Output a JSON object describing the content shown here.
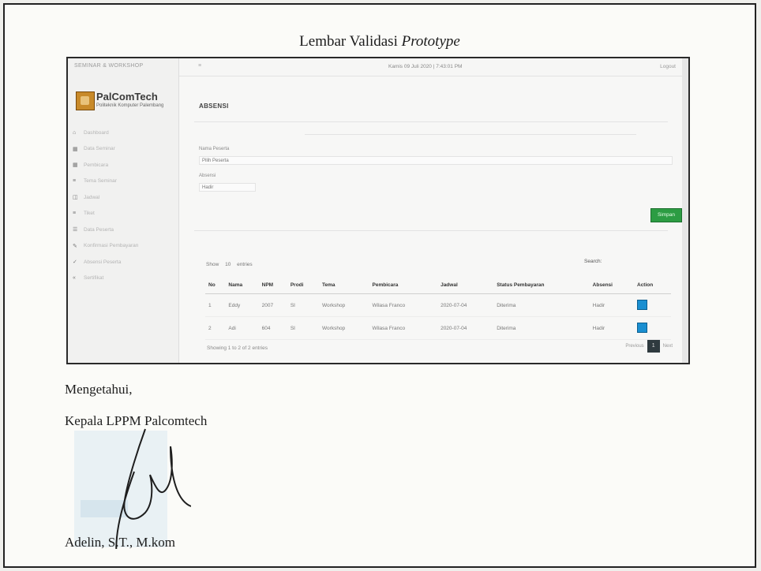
{
  "document": {
    "title_prefix": "Lembar Validasi",
    "title_italic": "Prototype",
    "acknowledged": "Mengetahui,",
    "position": "Kepala LPPM Palcomtech",
    "signer": "Adelin, S.T., M.kom"
  },
  "app": {
    "sidebar_header": "SEMINAR & WORKSHOP",
    "logo_name": "PalComTech",
    "logo_tagline": "Politeknik Komputer Palembang",
    "menu": [
      {
        "icon": "home-icon",
        "glyph": "⌂",
        "label": "Dashboard"
      },
      {
        "icon": "grid-icon",
        "glyph": "▦",
        "label": "Data Seminar"
      },
      {
        "icon": "grid-icon",
        "glyph": "▦",
        "label": "Pembicara"
      },
      {
        "icon": "list-icon",
        "glyph": "≡",
        "label": "Tema Seminar"
      },
      {
        "icon": "calendar-icon",
        "glyph": "◫",
        "label": "Jadwal"
      },
      {
        "icon": "list-icon",
        "glyph": "≡",
        "label": "Tiket"
      },
      {
        "icon": "users-icon",
        "glyph": "☰",
        "label": "Data Peserta"
      },
      {
        "icon": "edit-icon",
        "glyph": "✎",
        "label": "Konfirmasi Pembayaran"
      },
      {
        "icon": "check-icon",
        "glyph": "✓",
        "label": "Absensi Peserta"
      },
      {
        "icon": "chevron-icon",
        "glyph": "«",
        "label": "Sertifikat"
      }
    ],
    "topbar_toggle": "≡",
    "topbar_datetime": "Kamis 09 Juli 2020 | 7:43:01 PM",
    "topbar_logout": "Logout",
    "panel_title": "ABSENSI",
    "form": {
      "participant_label": "Nama Peserta",
      "participant_value": "Pilih Peserta",
      "attendance_label": "Absensi",
      "attendance_value": "Hadir"
    },
    "save_button": "Simpan",
    "show_label": "Show",
    "show_value": "10",
    "entries_label": "entries",
    "search_label": "Search:",
    "table": {
      "headers": [
        "No",
        "Nama",
        "NPM",
        "Prodi",
        "Tema",
        "Pembicara",
        "Jadwal",
        "Status Pembayaran",
        "Absensi",
        "Action"
      ],
      "rows": [
        [
          "1",
          "Eddy",
          "2007",
          "SI",
          "Workshop",
          "Wilasa Franco",
          "2020-07-04",
          "Diterima",
          "Hadir",
          ""
        ],
        [
          "2",
          "Adi",
          "604",
          "SI",
          "Workshop",
          "Wilasa Franco",
          "2020-07-04",
          "Diterima",
          "Hadir",
          ""
        ]
      ]
    },
    "footer_showing": "Showing 1 to 2 of 2 entries",
    "pager": {
      "previous": "Previous",
      "page": "1",
      "next": "Next"
    },
    "accent_green": "#2c9c43",
    "accent_blue": "#1a8fd1"
  }
}
